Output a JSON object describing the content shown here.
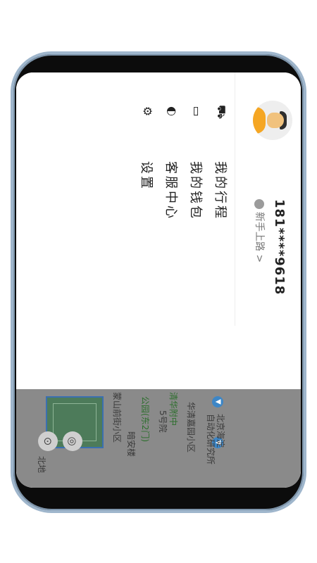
{
  "profile": {
    "phone": "181****9618",
    "level": "新手上路 >"
  },
  "menu": [
    {
      "icon": "car-icon",
      "label": "我的行程"
    },
    {
      "icon": "wallet-icon",
      "label": "我的钱包"
    },
    {
      "icon": "headset-icon",
      "label": "客服中心"
    },
    {
      "icon": "gear-icon",
      "label": "设置"
    }
  ],
  "map": {
    "labels": {
      "l1": "北京海淀",
      "l2": "自动化研究所",
      "l3": "华清嘉园小区",
      "l4": "清华附中",
      "l5": "5号院",
      "l6": "公园(东2门)",
      "l7": "暗安楼",
      "l8": "蒙山前街小区",
      "l9": "北地"
    }
  }
}
